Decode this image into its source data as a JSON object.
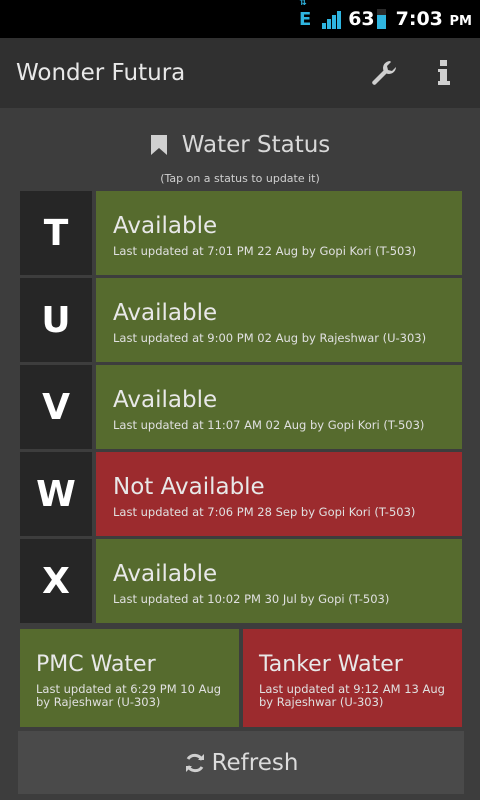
{
  "status_bar": {
    "network_label": "E",
    "battery_percent": "63",
    "time": "7:03",
    "time_suffix": "PM"
  },
  "action_bar": {
    "title": "Wonder Futura",
    "icons": [
      "wrench-icon",
      "info-icon"
    ]
  },
  "main": {
    "section_title": "Water Status",
    "section_icon": "bookmark-icon",
    "hint": "(Tap on a status to update it)",
    "rows": [
      {
        "letter": "T",
        "status": "Available",
        "meta": "Last updated at 7:01 PM 22 Aug by Gopi Kori (T-503)",
        "color": "#566b2e"
      },
      {
        "letter": "U",
        "status": "Available",
        "meta": "Last updated at 9:00 PM 02 Aug by Rajeshwar (U-303)",
        "color": "#566b2e"
      },
      {
        "letter": "V",
        "status": "Available",
        "meta": "Last updated at 11:07 AM 02 Aug by Gopi Kori (T-503)",
        "color": "#566b2e"
      },
      {
        "letter": "W",
        "status": "Not Available",
        "meta": "Last updated at 7:06 PM 28 Sep by Gopi Kori (T-503)",
        "color": "#9c2b2e"
      },
      {
        "letter": "X",
        "status": "Available",
        "meta": "Last updated at 10:02 PM 30 Jul by Gopi (T-503)",
        "color": "#566b2e"
      }
    ],
    "tiles": [
      {
        "title": "PMC Water",
        "meta": "Last updated at 6:29 PM 10 Aug by Rajeshwar (U-303)",
        "color": "#566b2e"
      },
      {
        "title": "Tanker Water",
        "meta": "Last updated at 9:12 AM 13 Aug by Rajeshwar (U-303)",
        "color": "#9c2b2e"
      }
    ],
    "refresh_label": "Refresh",
    "refresh_icon": "refresh-icon"
  }
}
